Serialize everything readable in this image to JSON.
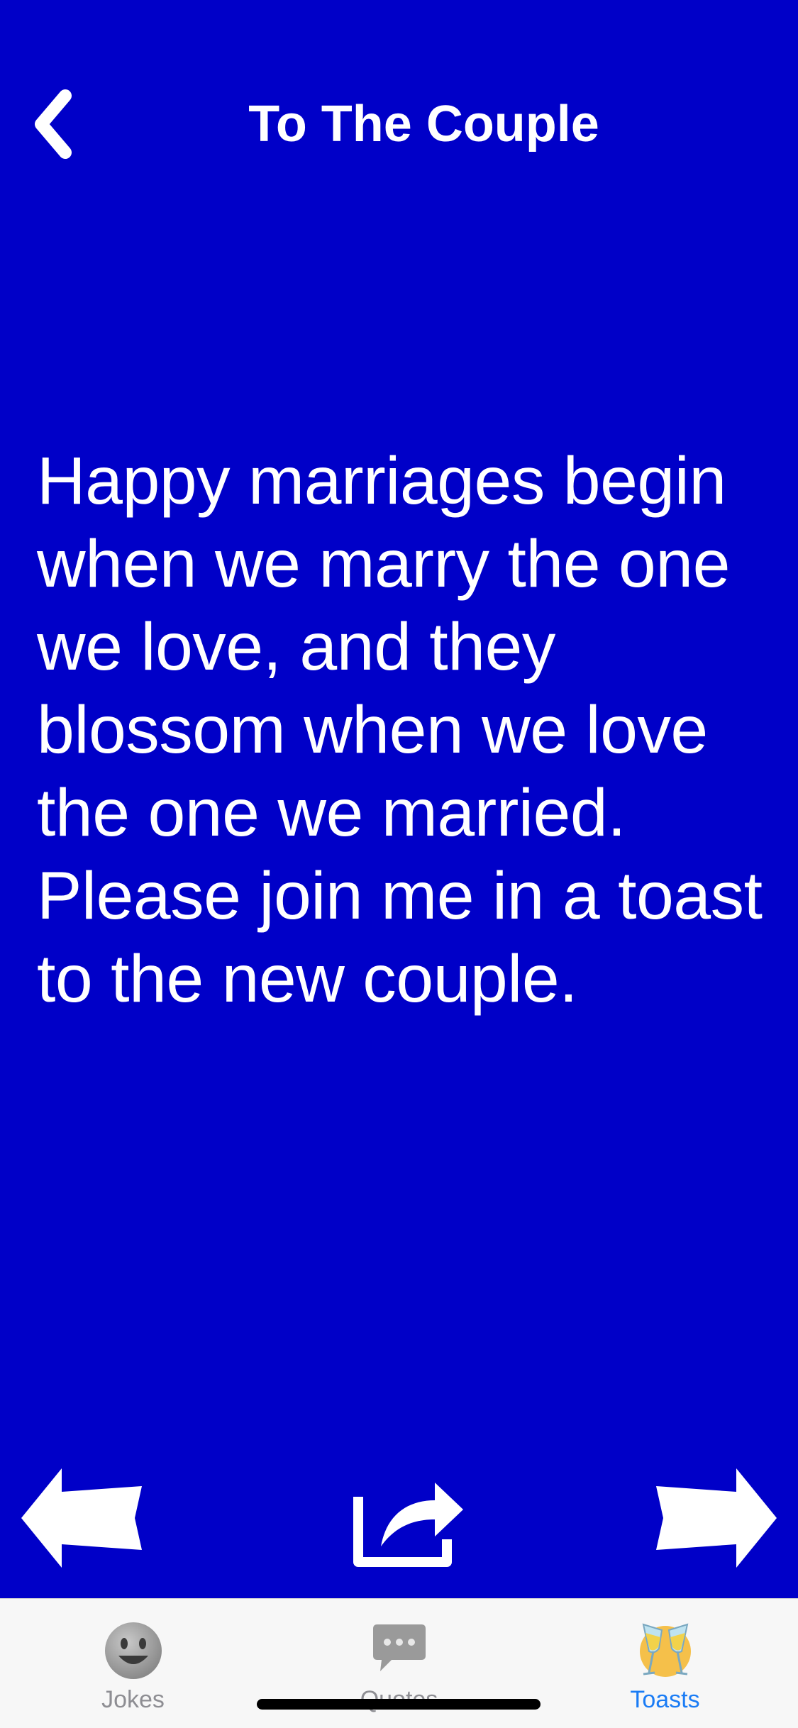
{
  "header": {
    "title": "To The Couple",
    "back_icon": "chevron-left-icon"
  },
  "toast": {
    "text": "Happy marriages begin when we marry the one we love, and they blossom when we love the one we married. Please join me in a toast to the new couple."
  },
  "actions": {
    "prev_icon": "arrow-left-icon",
    "share_icon": "share-icon",
    "next_icon": "arrow-right-icon"
  },
  "tabbar": {
    "tabs": [
      {
        "label": "Jokes",
        "icon": "smiley-face-icon",
        "active": false
      },
      {
        "label": "Quotes",
        "icon": "speech-bubble-icon",
        "active": false
      },
      {
        "label": "Toasts",
        "icon": "champagne-glasses-icon",
        "active": true
      }
    ]
  },
  "colors": {
    "background": "#0000c8",
    "text": "#ffffff",
    "tab_active": "#1a7cf5",
    "tab_inactive": "#8e8e93",
    "tabbar_bg": "#f7f7f7"
  }
}
